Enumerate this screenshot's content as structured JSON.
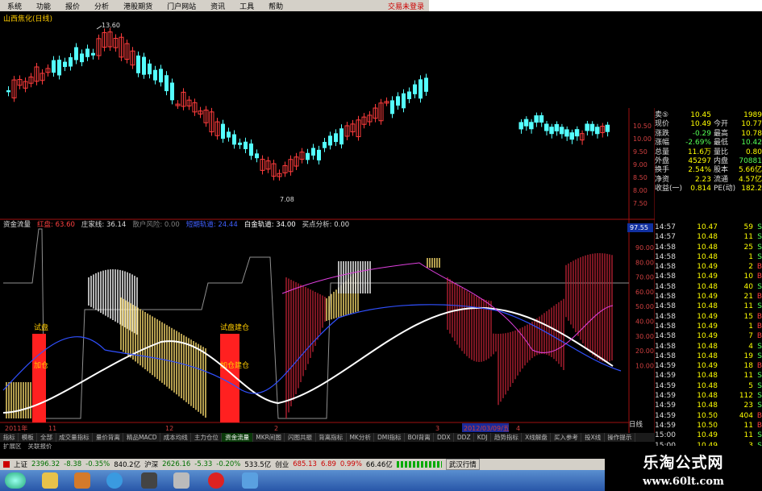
{
  "menu": {
    "items": [
      "系统",
      "功能",
      "报价",
      "分析",
      "港股期货",
      "门户网站",
      "资讯",
      "工具",
      "帮助"
    ],
    "status": "交易未登录"
  },
  "stock": {
    "name": "山西焦化(日线)"
  },
  "price_chart": {
    "price_axis_labels": [
      "10.50",
      "10.00",
      "9.50",
      "9.00",
      "8.50",
      "8.00",
      "7.50"
    ],
    "high_marker": "13.60",
    "low_marker": "7.08",
    "colors": {
      "up": "#ff3c3c",
      "down": "#54ffff",
      "ma": "#ffffff"
    }
  },
  "indicator": {
    "header": [
      {
        "label": "资金流量",
        "color": "#dddddd"
      },
      {
        "label": "红盘: 63.60",
        "color": "#ff4040"
      },
      {
        "label": "庄家线: 36.14",
        "color": "#dddddd"
      },
      {
        "label": "散户风险: 0.00",
        "color": "#7f7f7f"
      },
      {
        "label": "短期轨道: 24.44",
        "color": "#4060ff"
      },
      {
        "label": "白金轨道: 34.00",
        "color": "#ffffff"
      },
      {
        "label": "买点分析: 0.00",
        "color": "#dddddd"
      }
    ],
    "right_axis": [
      "90.00",
      "80.00",
      "70.00",
      "60.00",
      "50.00",
      "40.00",
      "30.00",
      "20.00",
      "10.00"
    ],
    "top_value": "97.55",
    "markers": [
      {
        "text": "试盘",
        "sub": "加仓"
      },
      {
        "text": "试盘建仓",
        "sub": "加仓建仓"
      }
    ],
    "date_axis": [
      "2011年",
      "11",
      "12",
      "2",
      "3",
      "4",
      "2012/03/09/五"
    ],
    "bottom_right": "日线"
  },
  "quote": {
    "rows": [
      {
        "a": "卖⑤",
        "b": "10.45",
        "c": "",
        "d": "1989"
      },
      {
        "a": "现价",
        "b": "10.49",
        "c": "今开",
        "d": "10.77"
      },
      {
        "a": "涨跌",
        "b": "-0.29",
        "c": "最高",
        "d": "10.78"
      },
      {
        "a": "涨幅",
        "b": "-2.69%",
        "c": "最低",
        "d": "10.42"
      },
      {
        "a": "总量",
        "b": "11.6万",
        "c": "量比",
        "d": "0.80"
      },
      {
        "a": "外盘",
        "b": "45297",
        "c": "内盘",
        "d": "70881"
      },
      {
        "a": "换手",
        "b": "2.54%",
        "c": "股本",
        "d": "5.66亿"
      },
      {
        "a": "净资",
        "b": "2.23",
        "c": "流通",
        "d": "4.57亿"
      },
      {
        "a": "收益(一)",
        "b": "0.814",
        "c": "PE(动)",
        "d": "182.2"
      }
    ]
  },
  "ticks": [
    {
      "t": "14:57",
      "p": "10.47",
      "v": "59",
      "s": "S"
    },
    {
      "t": "14:57",
      "p": "10.48",
      "v": "11",
      "s": "S"
    },
    {
      "t": "14:58",
      "p": "10.48",
      "v": "25",
      "s": "S"
    },
    {
      "t": "14:58",
      "p": "10.48",
      "v": "1",
      "s": "S"
    },
    {
      "t": "14:58",
      "p": "10.49",
      "v": "2",
      "s": "B"
    },
    {
      "t": "14:58",
      "p": "10.49",
      "v": "10",
      "s": "B"
    },
    {
      "t": "14:58",
      "p": "10.48",
      "v": "40",
      "s": "S"
    },
    {
      "t": "14:58",
      "p": "10.49",
      "v": "21",
      "s": "B"
    },
    {
      "t": "14:58",
      "p": "10.48",
      "v": "11",
      "s": "S"
    },
    {
      "t": "14:58",
      "p": "10.49",
      "v": "15",
      "s": "B"
    },
    {
      "t": "14:58",
      "p": "10.49",
      "v": "1",
      "s": "B"
    },
    {
      "t": "14:58",
      "p": "10.49",
      "v": "7",
      "s": "B"
    },
    {
      "t": "14:58",
      "p": "10.48",
      "v": "4",
      "s": "S"
    },
    {
      "t": "14:58",
      "p": "10.48",
      "v": "19",
      "s": "S"
    },
    {
      "t": "14:59",
      "p": "10.49",
      "v": "18",
      "s": "B"
    },
    {
      "t": "14:59",
      "p": "10.48",
      "v": "11",
      "s": "S"
    },
    {
      "t": "14:59",
      "p": "10.48",
      "v": "5",
      "s": "S"
    },
    {
      "t": "14:59",
      "p": "10.48",
      "v": "112",
      "s": "S"
    },
    {
      "t": "14:59",
      "p": "10.48",
      "v": "23",
      "s": "S"
    },
    {
      "t": "14:59",
      "p": "10.50",
      "v": "404",
      "s": "B"
    },
    {
      "t": "14:59",
      "p": "10.50",
      "v": "11",
      "s": "B"
    },
    {
      "t": "15:00",
      "p": "10.49",
      "v": "11",
      "s": "S"
    },
    {
      "t": "15:00",
      "p": "10.49",
      "v": "3",
      "s": "S"
    }
  ],
  "tabs": {
    "row1": [
      "指标",
      "模板",
      "全部",
      "成交量指标",
      "量价背离",
      "精品MACD",
      "成本均线",
      "主力仓位",
      "资金流量",
      "MKR间图",
      "闪图共振",
      "背离指标",
      "MK分析",
      "DMI指标",
      "BOI背离",
      "DDX",
      "DDZ",
      "KDJ",
      "趋势指标",
      "X线解盘",
      "买入参考",
      "投X线",
      "操作提示"
    ],
    "active": "资金流量",
    "row2": [
      "扩展区",
      "关联报价"
    ]
  },
  "ticker": {
    "sh_label": "上证",
    "sh_val": "2396.32",
    "sh_chg": "-8.38",
    "sh_pct": "-0.35%",
    "sh_amt": "840.2亿",
    "sz_label": "沪深",
    "sz_val": "2626.16",
    "sz_chg": "-5.33",
    "sz_pct": "-0.20%",
    "sz_amt": "533.5亿",
    "cy_label": "创业",
    "cy_val": "685.13",
    "cy_chg": "6.89",
    "cy_pct": "0.99%",
    "cy_amt": "66.46亿",
    "extra": "武汉行情"
  },
  "watermark": {
    "cn": "乐淘公式网",
    "url": "www.60lt.com"
  }
}
